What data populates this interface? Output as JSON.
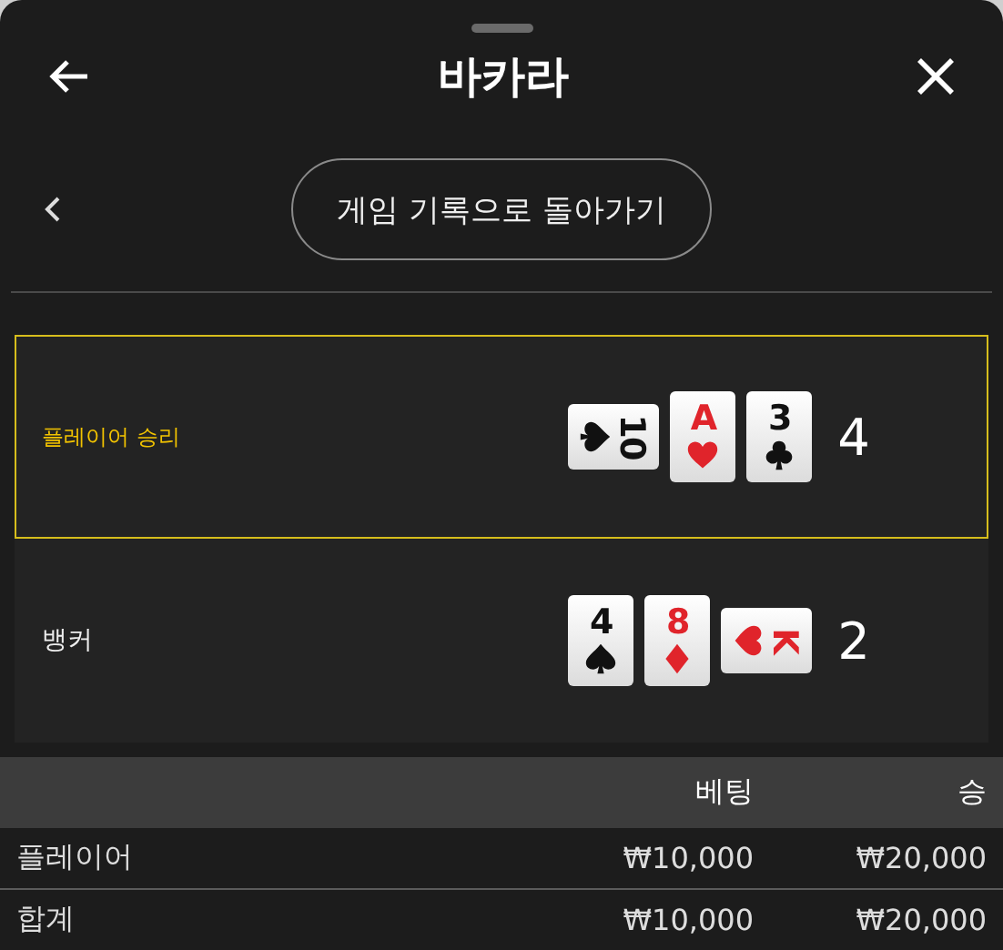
{
  "header": {
    "title": "바카라"
  },
  "nav": {
    "back_button": "게임 기록으로 돌아가기"
  },
  "hands": [
    {
      "name": "플레이어 승리",
      "selected": true,
      "score": "4",
      "cards": [
        {
          "rank": "10",
          "kind": "spade",
          "sideways": true
        },
        {
          "rank": "A",
          "kind": "heart",
          "sideways": false
        },
        {
          "rank": "3",
          "kind": "club",
          "sideways": false
        }
      ]
    },
    {
      "name": "뱅커",
      "selected": false,
      "score": "2",
      "cards": [
        {
          "rank": "4",
          "kind": "spade",
          "sideways": false
        },
        {
          "rank": "8",
          "kind": "diamond",
          "sideways": false
        },
        {
          "rank": "K",
          "kind": "heart",
          "sideways": true
        }
      ]
    }
  ],
  "table": {
    "columns": [
      "",
      "베팅",
      "승"
    ],
    "rows": [
      [
        "플레이어",
        "₩10,000",
        "₩20,000"
      ],
      [
        "합계",
        "₩10,000",
        "₩20,000"
      ]
    ]
  }
}
